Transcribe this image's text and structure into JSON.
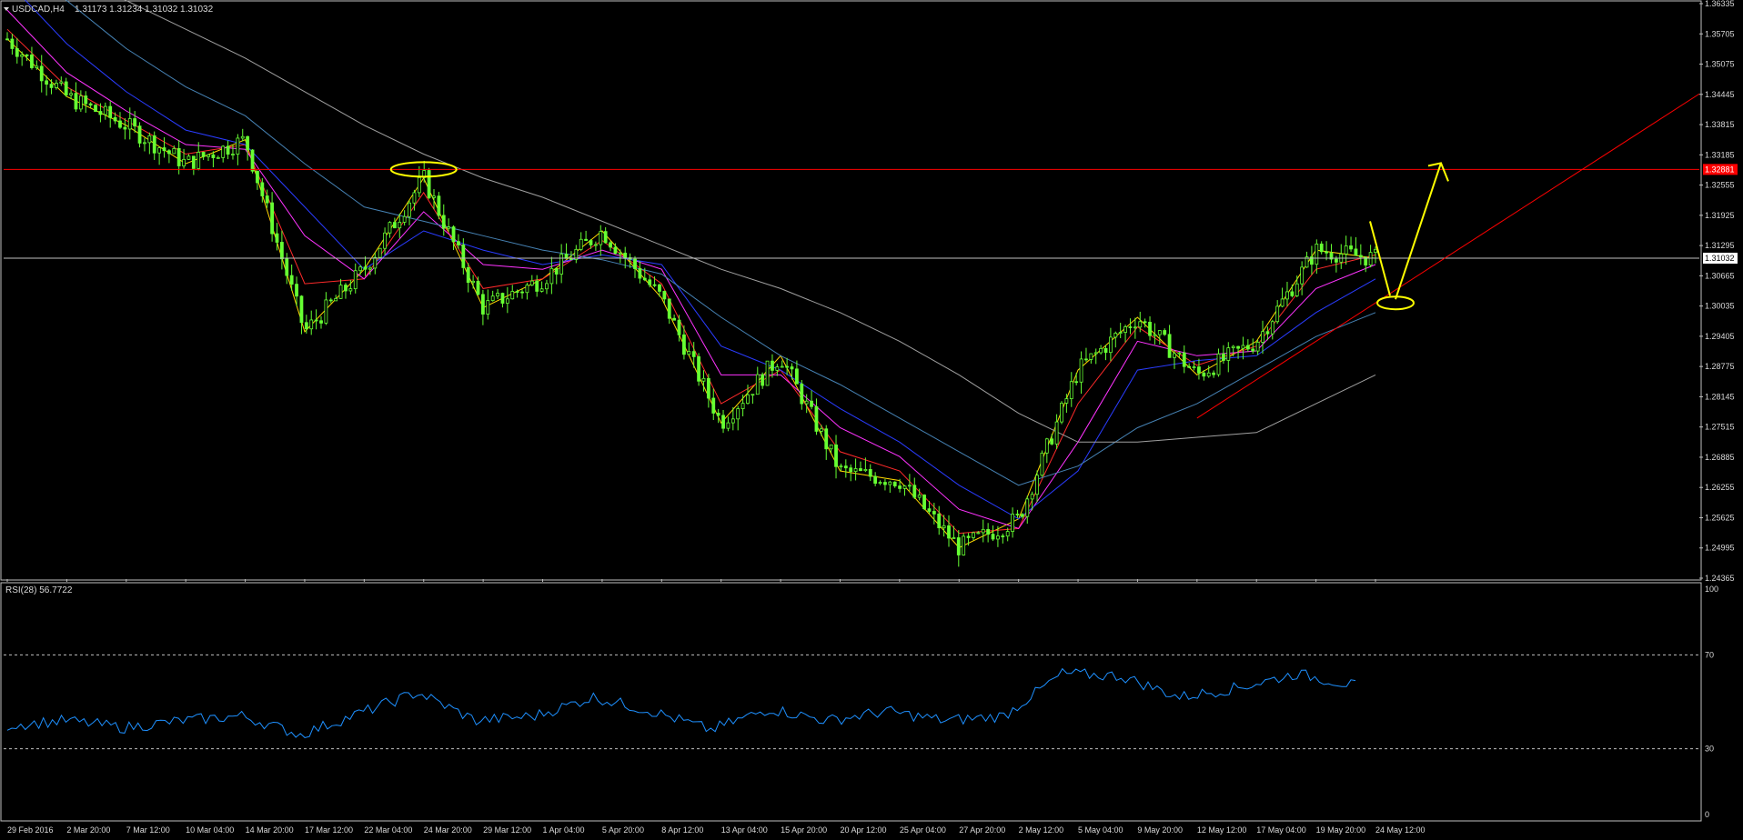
{
  "header": {
    "symbol_tf": "USDCAD,H4",
    "ohlc": "1.31173 1.31234 1.31032 1.31032"
  },
  "colors": {
    "background": "#000000",
    "frame": "#bfbfbf",
    "text": "#d9d9d9",
    "candle": "#66ff33",
    "resistance": "#ff0000",
    "current_price": "#c0c0c0",
    "rsi_line": "#1e90ff",
    "annotation": "#ffff00",
    "ma_fast": "#ffd700",
    "ma_red": "#ff2a2a",
    "ma_magenta": "#ff33ff",
    "ma_blue": "#2a3cff",
    "ma_steelblue": "#4682b4",
    "ma_gray": "#a0a0a0"
  },
  "price_axis": {
    "ticks": [
      "1.36335",
      "1.35705",
      "1.35075",
      "1.34445",
      "1.33815",
      "1.33185",
      "1.32555",
      "1.31925",
      "1.31295",
      "1.30665",
      "1.30035",
      "1.29405",
      "1.28775",
      "1.28145",
      "1.27515",
      "1.26885",
      "1.26255",
      "1.25625",
      "1.24995",
      "1.24365"
    ],
    "resistance_label": "1.32881",
    "current_label": "1.31032"
  },
  "time_axis": {
    "ticks": [
      "29 Feb 2016",
      "2 Mar 20:00",
      "7 Mar 12:00",
      "10 Mar 04:00",
      "14 Mar 20:00",
      "17 Mar 12:00",
      "22 Mar 04:00",
      "24 Mar 20:00",
      "29 Mar 12:00",
      "1 Apr 04:00",
      "5 Apr 20:00",
      "8 Apr 12:00",
      "13 Apr 04:00",
      "15 Apr 20:00",
      "20 Apr 12:00",
      "25 Apr 04:00",
      "27 Apr 20:00",
      "2 May 12:00",
      "5 May 04:00",
      "9 May 20:00",
      "12 May 12:00",
      "17 May 04:00",
      "19 May 20:00",
      "24 May 12:00"
    ]
  },
  "rsi": {
    "label": "RSI(28) 56.7722",
    "levels": [
      "100",
      "70",
      "30",
      "0"
    ]
  },
  "chart_data": [
    {
      "type": "candlestick",
      "symbol": "USDCAD",
      "timeframe": "H4",
      "x": [
        "29 Feb 2016",
        "2 Mar 20:00",
        "7 Mar 12:00",
        "10 Mar 04:00",
        "14 Mar 20:00",
        "17 Mar 12:00",
        "22 Mar 04:00",
        "24 Mar 20:00",
        "29 Mar 12:00",
        "1 Apr 04:00",
        "5 Apr 20:00",
        "8 Apr 12:00",
        "13 Apr 04:00",
        "15 Apr 20:00",
        "20 Apr 12:00",
        "25 Apr 04:00",
        "27 Apr 20:00",
        "2 May 12:00",
        "5 May 04:00",
        "9 May 20:00",
        "12 May 12:00",
        "17 May 04:00",
        "19 May 20:00",
        "24 May 12:00"
      ],
      "close": [
        1.356,
        1.344,
        1.338,
        1.33,
        1.335,
        1.295,
        1.308,
        1.327,
        1.3,
        1.306,
        1.316,
        1.302,
        1.276,
        1.29,
        1.266,
        1.264,
        1.25,
        1.256,
        1.287,
        1.298,
        1.286,
        1.293,
        1.312,
        1.3103
      ],
      "ylim": [
        1.24365,
        1.36335
      ],
      "horizontal_lines": [
        {
          "name": "resistance",
          "value": 1.32881
        },
        {
          "name": "current",
          "value": 1.31032
        }
      ],
      "trendline": {
        "x": [
          "12 May 12:00",
          "24 May 12:00"
        ],
        "y": [
          1.277,
          1.301
        ]
      },
      "moving_averages": [
        {
          "color": "#ffd700",
          "values": [
            1.356,
            1.344,
            1.338,
            1.33,
            1.335,
            1.295,
            1.308,
            1.327,
            1.3,
            1.306,
            1.316,
            1.302,
            1.276,
            1.29,
            1.266,
            1.264,
            1.25,
            1.256,
            1.287,
            1.298,
            1.286,
            1.293,
            1.312,
            1.3103
          ]
        },
        {
          "color": "#ff2a2a",
          "values": [
            1.358,
            1.346,
            1.339,
            1.332,
            1.334,
            1.305,
            1.306,
            1.324,
            1.304,
            1.306,
            1.314,
            1.305,
            1.28,
            1.287,
            1.27,
            1.266,
            1.253,
            1.254,
            1.28,
            1.296,
            1.288,
            1.292,
            1.308,
            1.311
          ]
        },
        {
          "color": "#ff33ff",
          "values": [
            1.362,
            1.349,
            1.341,
            1.334,
            1.333,
            1.315,
            1.306,
            1.32,
            1.309,
            1.308,
            1.312,
            1.308,
            1.286,
            1.286,
            1.275,
            1.269,
            1.258,
            1.254,
            1.272,
            1.293,
            1.29,
            1.291,
            1.304,
            1.309
          ]
        },
        {
          "color": "#2a3cff",
          "values": [
            1.368,
            1.355,
            1.345,
            1.337,
            1.334,
            1.321,
            1.308,
            1.316,
            1.312,
            1.309,
            1.311,
            1.309,
            1.292,
            1.287,
            1.279,
            1.272,
            1.263,
            1.256,
            1.266,
            1.287,
            1.289,
            1.29,
            1.299,
            1.306
          ]
        },
        {
          "color": "#4682b4",
          "values": [
            1.372,
            1.364,
            1.354,
            1.346,
            1.34,
            1.33,
            1.321,
            1.318,
            1.315,
            1.312,
            1.31,
            1.307,
            1.298,
            1.29,
            1.284,
            1.277,
            1.27,
            1.263,
            1.267,
            1.275,
            1.28,
            1.287,
            1.294,
            1.299
          ]
        },
        {
          "color": "#a0a0a0",
          "values": [
            1.375,
            1.37,
            1.364,
            1.358,
            1.352,
            1.345,
            1.338,
            1.332,
            1.327,
            1.323,
            1.318,
            1.313,
            1.308,
            1.304,
            1.299,
            1.293,
            1.286,
            1.278,
            1.272,
            1.272,
            1.273,
            1.274,
            1.28,
            1.286
          ]
        }
      ],
      "annotations": {
        "resistance_ellipse": {
          "x": "24 Mar 20:00",
          "y": 1.32881
        },
        "support_ellipse": {
          "x": "24 May 12:00",
          "y": 1.301
        },
        "arrow_down": {
          "from": {
            "x": "24 May 12:00",
            "y": 1.318
          },
          "to": {
            "x": "24 May 12:00",
            "y": 1.301
          }
        },
        "arrow_up": {
          "from": {
            "x": "24 May 12:00",
            "y": 1.301
          },
          "to": {
            "x": "24 May 12:00",
            "y": 1.329
          }
        }
      }
    },
    {
      "type": "line",
      "title": "RSI(28) 56.7722",
      "x": [
        "29 Feb 2016",
        "2 Mar 20:00",
        "7 Mar 12:00",
        "10 Mar 04:00",
        "14 Mar 20:00",
        "17 Mar 12:00",
        "22 Mar 04:00",
        "24 Mar 20:00",
        "29 Mar 12:00",
        "1 Apr 04:00",
        "5 Apr 20:00",
        "8 Apr 12:00",
        "13 Apr 04:00",
        "15 Apr 20:00",
        "20 Apr 12:00",
        "25 Apr 04:00",
        "27 Apr 20:00",
        "2 May 12:00",
        "5 May 04:00",
        "9 May 20:00",
        "12 May 12:00",
        "17 May 04:00",
        "19 May 20:00",
        "24 May 12:00"
      ],
      "values": [
        40,
        42,
        39,
        42,
        44,
        36,
        45,
        54,
        42,
        44,
        52,
        46,
        38,
        47,
        42,
        46,
        42,
        44,
        62,
        61,
        52,
        56,
        62,
        56.8
      ],
      "ylim": [
        0,
        100
      ],
      "levels": [
        30,
        70
      ]
    }
  ]
}
